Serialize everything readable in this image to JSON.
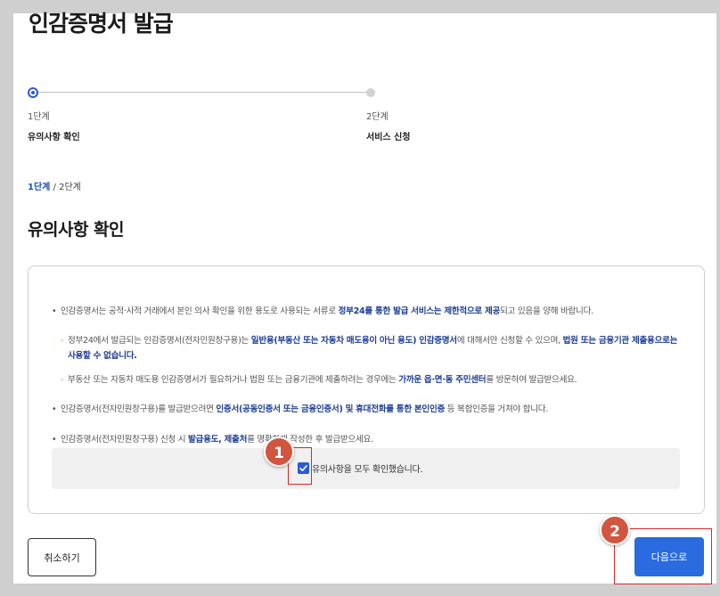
{
  "page": {
    "title": "인감증명서 발급"
  },
  "stepper": {
    "steps": [
      {
        "num": "1단계",
        "name": "유의사항 확인"
      },
      {
        "num": "2단계",
        "name": "서비스 신청"
      }
    ]
  },
  "breadcrumb": {
    "current": "1단계",
    "separator": " / ",
    "next": "2단계"
  },
  "section": {
    "title": "유의사항 확인"
  },
  "notices": {
    "n1": {
      "pre": "인감증명서는 공적·사적 거래에서 본인 의사 확인을 위한 용도로 사용되는 서류로 ",
      "bold": "정부24를 통한 발급 서비스는 제한적으로 제공",
      "post": "되고 있음을 양해 바랍니다."
    },
    "n1a": {
      "pre": "정부24에서 발급되는 인감증명서(전자민원창구용)는 ",
      "bold1": "일반용(부동산 또는 자동차 매도용이 아닌 용도) 인감증명서",
      "mid": "에 대해서만 신청할 수 있으며, ",
      "bold2": "법원 또는 금융기관 제출용으로는 사용할 수 없습니다."
    },
    "n1b": {
      "pre": "부동산 또는 자동차 매도용 인감증명서가 필요하거나 법원 또는 금융기관에 제출하려는 경우에는 ",
      "bold": "가까운 읍·면·동 주민센터",
      "post": "를 방문하여 발급받으세요."
    },
    "n2": {
      "pre": "인감증명서(전자민원창구용)를 발급받으려면 ",
      "bold": "인증서(공동인증서 또는 금융인증서) 및 휴대전화를 통한 본인인증",
      "post": " 등 복합인증을 거쳐야 합니다."
    },
    "n3": {
      "pre": "인감증명서(전자민원창구용) 신청 시 ",
      "bold": "발급용도, 제출처",
      "post": "를 명확하게 작성한 후 발급받으세요."
    }
  },
  "confirm": {
    "label": "유의사항을 모두 확인했습니다.",
    "checked": true
  },
  "annotations": {
    "one": "1",
    "two": "2",
    "color": "#d2553f"
  },
  "buttons": {
    "cancel": "취소하기",
    "next": "다음으로"
  },
  "colors": {
    "accent": "#2a6bdf",
    "highlight": "#1f3f96",
    "marker": "#d6282a"
  }
}
